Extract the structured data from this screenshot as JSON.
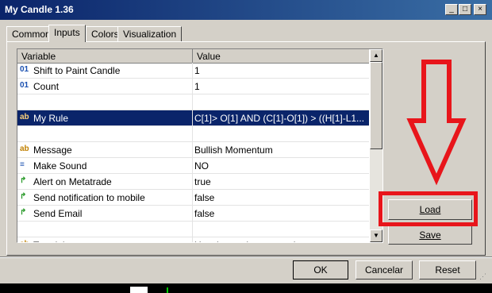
{
  "window": {
    "title": "My Candle 1.36",
    "controls": [
      "_",
      "□",
      "×"
    ]
  },
  "tabs": [
    "Common",
    "Inputs",
    "Colors",
    "Visualization"
  ],
  "active_tab": "Inputs",
  "grid": {
    "headers": {
      "variable": "Variable",
      "value": "Value"
    },
    "rows": [
      {
        "icon": "01",
        "name": "Shift to Paint Candle",
        "value": "1"
      },
      {
        "icon": "01",
        "name": "Count",
        "value": "1"
      },
      {
        "icon": "",
        "name": "",
        "value": ""
      },
      {
        "icon": "ab",
        "name": "My Rule",
        "value": "C[1]> O[1] AND  (C[1]-O[1])  > ((H[1]-L1..."
      },
      {
        "icon": "",
        "name": "",
        "value": ""
      },
      {
        "icon": "ab",
        "name": "Message",
        "value": "Bullish Momentum"
      },
      {
        "icon": "≡",
        "name": "Make Sound",
        "value": "NO"
      },
      {
        "icon": "↱",
        "name": "Alert on Metatrade",
        "value": "true"
      },
      {
        "icon": "↱",
        "name": "Send notification to mobile",
        "value": "false"
      },
      {
        "icon": "↱",
        "name": "Send Email",
        "value": "false"
      },
      {
        "icon": "",
        "name": "",
        "value": ""
      },
      {
        "icon": "ab",
        "name": "Tutorial",
        "value": "Use the mode to test rules on..."
      }
    ]
  },
  "buttons": {
    "load": "Load",
    "save": "Save",
    "ok": "OK",
    "cancel": "Cancelar",
    "reset": "Reset"
  },
  "colors": {
    "title_bar": "#0a246a",
    "selection": "#0a246a",
    "annotation": "#e8151b"
  }
}
